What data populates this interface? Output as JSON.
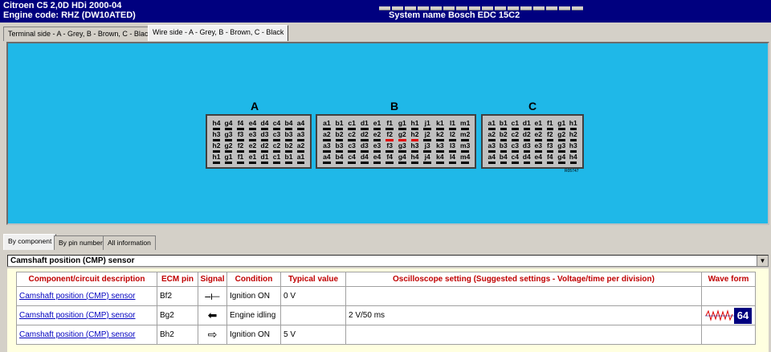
{
  "header": {
    "vehicle": "Citroen   C5  2,0D HDi 2000-04",
    "engine": "Engine code: RHZ (DW10ATED)",
    "system": "System name Bosch EDC 15C2"
  },
  "view_tabs": [
    {
      "label": "Terminal side - A - Grey, B - Brown, C - Black",
      "active": false
    },
    {
      "label": "Wire side - A - Grey, B - Brown, C - Black",
      "active": true
    }
  ],
  "connectors": {
    "A": {
      "label": "A",
      "cols": 8,
      "rows": [
        [
          "h4",
          "g4",
          "f4",
          "e4",
          "d4",
          "c4",
          "b4",
          "a4"
        ],
        [
          "h3",
          "g3",
          "f3",
          "e3",
          "d3",
          "c3",
          "b3",
          "a3"
        ],
        [
          "h2",
          "g2",
          "f2",
          "e2",
          "d2",
          "c2",
          "b2",
          "a2"
        ],
        [
          "h1",
          "g1",
          "f1",
          "e1",
          "d1",
          "c1",
          "b1",
          "a1"
        ]
      ]
    },
    "B": {
      "label": "B",
      "cols": 12,
      "rows": [
        [
          "a1",
          "b1",
          "c1",
          "d1",
          "e1",
          "f1",
          "g1",
          "h1",
          "j1",
          "k1",
          "l1",
          "m1"
        ],
        [
          "a2",
          "b2",
          "c2",
          "d2",
          "e2",
          "f2",
          "g2",
          "h2",
          "j2",
          "k2",
          "l2",
          "m2"
        ],
        [
          "a3",
          "b3",
          "c3",
          "d3",
          "e3",
          "f3",
          "g3",
          "h3",
          "j3",
          "k3",
          "l3",
          "m3"
        ],
        [
          "a4",
          "b4",
          "c4",
          "d4",
          "e4",
          "f4",
          "g4",
          "h4",
          "j4",
          "k4",
          "l4",
          "m4"
        ]
      ]
    },
    "C": {
      "label": "C",
      "cols": 8,
      "rows": [
        [
          "a1",
          "b1",
          "c1",
          "d1",
          "e1",
          "f1",
          "g1",
          "h1"
        ],
        [
          "a2",
          "b2",
          "c2",
          "d2",
          "e2",
          "f2",
          "g2",
          "h2"
        ],
        [
          "a3",
          "b3",
          "c3",
          "d3",
          "e3",
          "f3",
          "g3",
          "h3"
        ],
        [
          "a4",
          "b4",
          "c4",
          "d4",
          "e4",
          "f4",
          "g4",
          "h4"
        ]
      ]
    },
    "highlighted": {
      "B": [
        "f2",
        "g2",
        "h2"
      ]
    },
    "drawing_ref": "R05747"
  },
  "info_tabs": [
    "By component",
    "By pin number",
    "All information"
  ],
  "component_select": "Camshaft position (CMP) sensor",
  "table": {
    "headers": [
      "Component/circuit description",
      "ECM pin",
      "Signal",
      "Condition",
      "Typical value",
      "Oscilloscope setting (Suggested settings - Voltage/time per division)",
      "Wave form"
    ],
    "rows": [
      {
        "desc": "Camshaft position (CMP) sensor",
        "pin": "Bf2",
        "signal_icon": "signal-pulse-icon",
        "signal": "⎯⟝",
        "condition": "Ignition ON",
        "value": "0 V",
        "scope": "",
        "wave": ""
      },
      {
        "desc": "Camshaft position (CMP) sensor",
        "pin": "Bg2",
        "signal_icon": "arrow-left-icon",
        "signal": "⬅",
        "condition": "Engine idling",
        "value": "",
        "scope": "2 V/50 ms",
        "wave": "64"
      },
      {
        "desc": "Camshaft position (CMP) sensor",
        "pin": "Bh2",
        "signal_icon": "arrow-right-outline-icon",
        "signal": "⇨",
        "condition": "Ignition ON",
        "value": "5 V",
        "scope": "",
        "wave": ""
      }
    ]
  },
  "colors": {
    "header": "#00007f",
    "panel": "#1fb8e8",
    "header_text": "#c00000",
    "highlight": "#e00000"
  }
}
